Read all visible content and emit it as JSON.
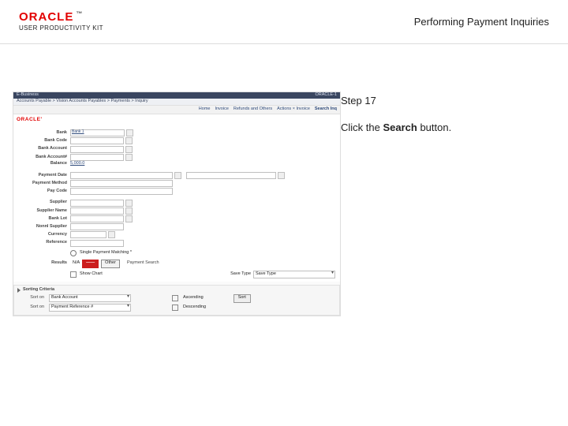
{
  "header": {
    "brand": "ORACLE",
    "brand_sub": "USER PRODUCTIVITY KIT",
    "topic": "Performing Payment Inquiries"
  },
  "instruction": {
    "step": "Step 17",
    "text_before": "Click the ",
    "bold": "Search",
    "text_after": " button."
  },
  "app": {
    "titlebar_left": "E-Business",
    "titlebar_right": "ORACLE-1",
    "crumb": "Accounts Payable  >  Vision Accounts Payables  >  Payments  >  Inquiry",
    "tabs": {
      "items": [
        "Home",
        "Invoice",
        "Refunds and Others",
        "Actions × Invoice"
      ],
      "active": "Search Inq"
    },
    "brand_mini": "ORACLE'",
    "fields": {
      "bank": {
        "label": "Bank",
        "value": "Bank 1"
      },
      "bank_code": {
        "label": "Bank Code"
      },
      "bank_account": {
        "label": "Bank Account"
      },
      "bank_account_no": {
        "label": "Bank Account#"
      },
      "balance": {
        "label": "Balance",
        "value": "5,000.0"
      },
      "payment_date": {
        "label": "Payment Date"
      },
      "payment_method": {
        "label": "Payment Method"
      },
      "pay_code": {
        "label": "Pay Code"
      },
      "supplier": {
        "label": "Supplier"
      },
      "supplier_name": {
        "label": "Supplier Name"
      },
      "bank_lot": {
        "label": "Bank Lot"
      },
      "nonnl_supplier": {
        "label": "Nonnl Supplier"
      },
      "currency": {
        "label": "Currency"
      },
      "reference": {
        "label": "Reference"
      }
    },
    "radio_label": "Single Payment Matching *",
    "results": {
      "label": "Results",
      "n_a": "N/A",
      "tab_current": "——",
      "tab_other": "Other",
      "right": "Payment Search"
    },
    "meta": {
      "show_chart": "Show Chart",
      "save_type_label": "Save Type",
      "save_type_value": "Save Type"
    },
    "sorting": {
      "title": "Sorting Criteria",
      "sort_label": "Sort on",
      "sort1": "Bank Account",
      "sort2": "Payment Reference #",
      "asc": "Ascending",
      "desc": "Descending",
      "action": "Sort"
    }
  }
}
